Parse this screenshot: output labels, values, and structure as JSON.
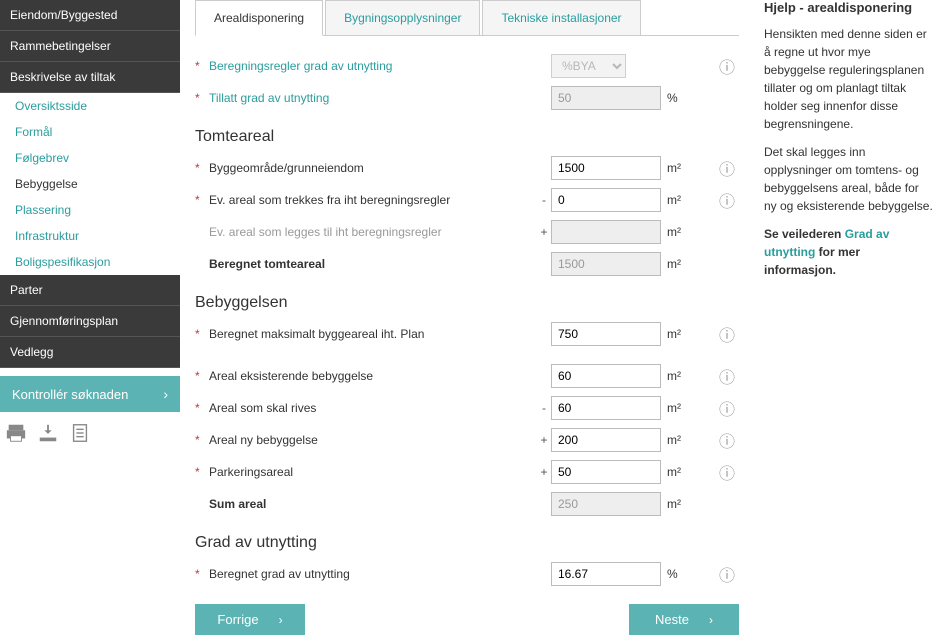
{
  "sidebar": {
    "items": [
      {
        "label": "Eiendom/Byggested",
        "type": "header"
      },
      {
        "label": "Rammebetingelser",
        "type": "header"
      },
      {
        "label": "Beskrivelse av tiltak",
        "type": "header",
        "active": true
      },
      {
        "label": "Oversiktsside",
        "type": "sub"
      },
      {
        "label": "Formål",
        "type": "sub"
      },
      {
        "label": "Følgebrev",
        "type": "sub"
      },
      {
        "label": "Bebyggelse",
        "type": "sub",
        "current": true
      },
      {
        "label": "Plassering",
        "type": "sub"
      },
      {
        "label": "Infrastruktur",
        "type": "sub"
      },
      {
        "label": "Boligspesifikasjon",
        "type": "sub"
      },
      {
        "label": "Parter",
        "type": "header"
      },
      {
        "label": "Gjennomføringsplan",
        "type": "header"
      },
      {
        "label": "Vedlegg",
        "type": "header"
      }
    ],
    "control_label": "Kontrollér søknaden"
  },
  "tabs": [
    {
      "label": "Arealdisponering",
      "active": true
    },
    {
      "label": "Bygningsopplysninger"
    },
    {
      "label": "Tekniske installasjoner"
    }
  ],
  "form": {
    "row_rules": {
      "label": "Beregningsregler grad av utnytting",
      "select": "%BYA"
    },
    "row_allowed": {
      "label": "Tillatt grad av utnytting",
      "value": "50",
      "unit": "%"
    },
    "section_tomt": "Tomteareal",
    "row_bygge": {
      "label": "Byggeområde/grunneiendom",
      "value": "1500",
      "unit": "m²"
    },
    "row_trek": {
      "label": "Ev. areal som trekkes fra iht beregningsregler",
      "op": "-",
      "value": "0",
      "unit": "m²"
    },
    "row_legg": {
      "label": "Ev. areal som legges til iht beregningsregler",
      "op": "+",
      "value": "",
      "unit": "m²"
    },
    "row_beregnet_tomt": {
      "label": "Beregnet tomteareal",
      "value": "1500",
      "unit": "m²"
    },
    "section_bebyg": "Bebyggelsen",
    "row_maks": {
      "label": "Beregnet maksimalt byggeareal iht. Plan",
      "value": "750",
      "unit": "m²"
    },
    "row_eksist": {
      "label": "Areal eksisterende bebyggelse",
      "value": "60",
      "unit": "m²"
    },
    "row_rives": {
      "label": "Areal som skal rives",
      "op": "-",
      "value": "60",
      "unit": "m²"
    },
    "row_ny": {
      "label": "Areal ny bebyggelse",
      "op": "+",
      "value": "200",
      "unit": "m²"
    },
    "row_park": {
      "label": "Parkeringsareal",
      "op": "+",
      "value": "50",
      "unit": "m²"
    },
    "row_sum": {
      "label": "Sum areal",
      "value": "250",
      "unit": "m²"
    },
    "section_grad": "Grad av utnytting",
    "row_grad": {
      "label": "Beregnet grad av utnytting",
      "value": "16.67",
      "unit": "%"
    }
  },
  "nav": {
    "prev": "Forrige",
    "next": "Neste"
  },
  "help": {
    "title": "Hjelp - arealdisponering",
    "p1": "Hensikten med denne siden er å regne ut hvor mye bebyggelse reguleringsplanen tillater og om planlagt tiltak holder seg innenfor disse begrensningene.",
    "p2": "Det skal legges inn opplysninger om tomtens- og bebyggelsens areal, både for ny og eksisterende bebyggelse.",
    "p3a": "Se veilederen ",
    "p3b": "Grad av utnytting",
    "p3c": " for mer informasjon."
  }
}
